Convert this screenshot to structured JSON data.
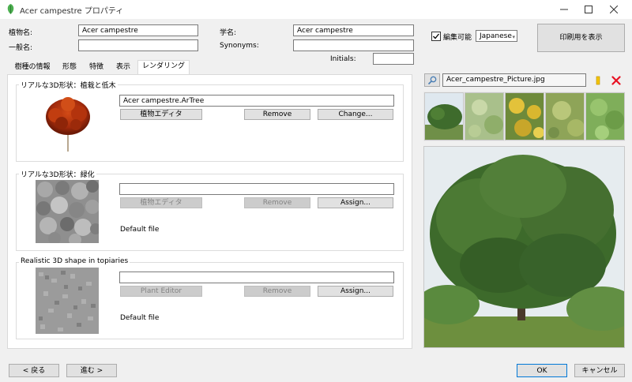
{
  "window": {
    "title": "Acer campestre プロパティ",
    "minimize_icon": "minimize-icon",
    "maximize_icon": "maximize-icon",
    "close_icon": "close-icon"
  },
  "form": {
    "plant_name_label": "植物名:",
    "plant_name_value": "Acer campestre",
    "common_name_label": "一般名:",
    "common_name_value": "",
    "scientific_name_label": "学名:",
    "scientific_name_value": "Acer campestre",
    "synonyms_label": "Synonyms:",
    "synonyms_value": "",
    "initials_label": "Initials:",
    "initials_value": "",
    "editable_label": "編集可能",
    "editable_checked": true,
    "language_value": "Japanese",
    "print_view_label": "印刷用を表示"
  },
  "tabs": [
    {
      "label": "樹種の情報"
    },
    {
      "label": "形態"
    },
    {
      "label": "特徴"
    },
    {
      "label": "表示"
    },
    {
      "label": "レンダリング"
    }
  ],
  "active_tab": "レンダリング",
  "rendering": {
    "group1": {
      "title": "リアルな3D形状：植栽と低木",
      "model_value": "Acer campestre.ArTree",
      "plant_editor_label": "植物エディタ",
      "remove_label": "Remove",
      "change_label": "Change..."
    },
    "group2": {
      "title": "リアルな3D形状：緑化",
      "model_value": "",
      "plant_editor_label": "植物エディタ",
      "remove_label": "Remove",
      "assign_label": "Assign...",
      "default_file": "Default file"
    },
    "group3": {
      "title": "Realistic 3D shape in topiaries",
      "model_value": "",
      "plant_editor_label": "Plant Editor",
      "remove_label": "Remove",
      "assign_label": "Assign...",
      "default_file": "Default file"
    }
  },
  "picture": {
    "filename": "Acer_campestre_Picture.jpg",
    "search_icon": "magnifier-icon",
    "star_icon": "star-icon",
    "delete_icon": "delete-x-icon"
  },
  "footer": {
    "back_label": "< 戻る",
    "next_label": "進む >",
    "ok_label": "OK",
    "cancel_label": "キャンセル"
  },
  "colors": {
    "accent_ok_border": "#0078d7",
    "delete_red": "#e81123",
    "star_yellow": "#f5c400"
  }
}
